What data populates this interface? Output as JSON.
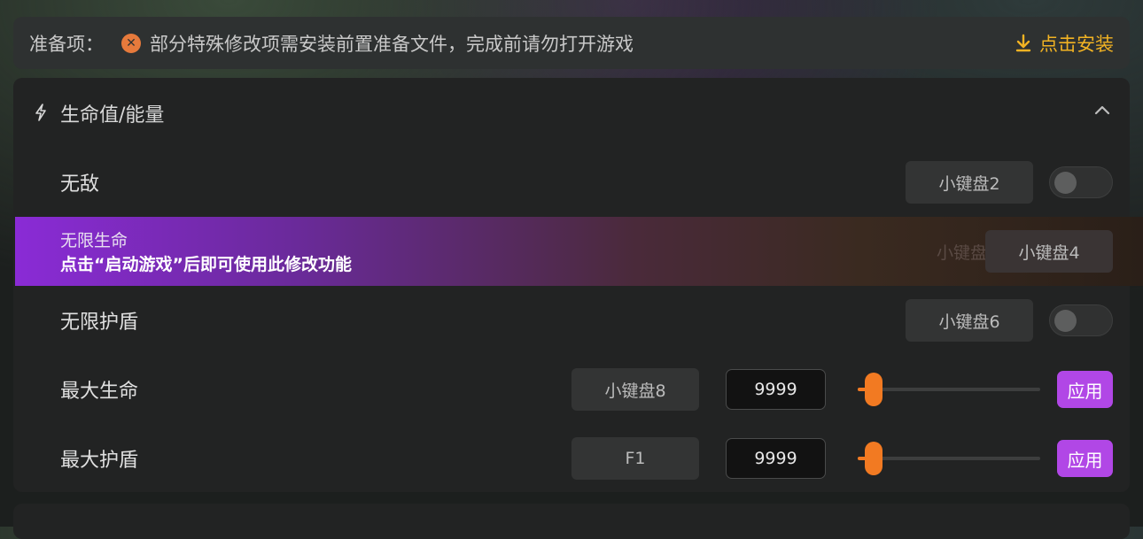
{
  "prep": {
    "label": "准备项：",
    "message": "部分特殊修改项需安装前置准备文件，完成前请勿打开游戏",
    "install_label": "点击安装"
  },
  "section": {
    "title": "生命值/能量"
  },
  "rows": {
    "invincible": {
      "label": "无敌",
      "hotkey": "小键盘2",
      "enabled": false
    },
    "infinite_health": {
      "label": "无限生命",
      "tip": "点击“启动游戏”后即可使用此修改功能",
      "ghost_hotkey": "小键盘4",
      "hotkey": "小键盘4"
    },
    "infinite_shield": {
      "label": "无限护盾",
      "hotkey": "小键盘6",
      "enabled": false
    },
    "max_health": {
      "label": "最大生命",
      "hotkey": "小键盘8",
      "value": "9999",
      "slider_level": 0.04,
      "apply_label": "应用"
    },
    "max_shield": {
      "label": "最大护盾",
      "hotkey": "F1",
      "value": "9999",
      "slider_level": 0.04,
      "apply_label": "应用"
    }
  },
  "colors": {
    "accent_orange": "#f27a22",
    "accent_purple": "#b147e6",
    "install_gold": "#f2b323",
    "warning": "#e67a3c"
  },
  "icons": {
    "warning": "close-circle-icon",
    "install": "download-icon",
    "section": "lightning-bolt-icon",
    "collapse": "chevron-up-icon"
  }
}
